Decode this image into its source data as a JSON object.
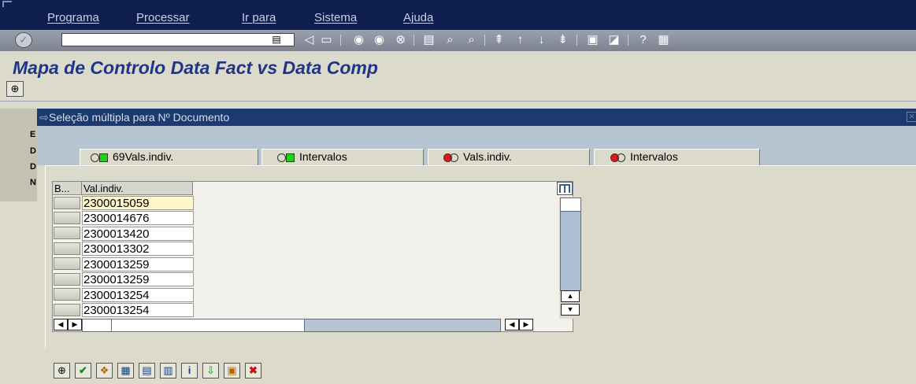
{
  "menu": {
    "items": [
      "Programa",
      "Processar",
      "Ir para",
      "Sistema",
      "Ajuda"
    ]
  },
  "toolbar": {
    "command_field_value": "",
    "icons": [
      "enter-icon",
      "back-icon",
      "save-icon",
      "back-nav-icon",
      "exit-icon",
      "cancel-icon",
      "print-icon",
      "find-icon",
      "find-next-icon",
      "first-page-icon",
      "previous-page-icon",
      "next-page-icon",
      "last-page-icon",
      "new-session-icon",
      "shortcut-icon",
      "help-icon",
      "layout-icon"
    ]
  },
  "page": {
    "title": "Mapa de Controlo Data Fact vs Data Comp"
  },
  "dialog": {
    "title": "Seleção múltipla para Nº Documento",
    "tabs": [
      {
        "label": "69Vals.indiv.",
        "status": "green",
        "active": true
      },
      {
        "label": "Intervalos",
        "status": "green",
        "active": false
      },
      {
        "label": "Vals.indiv.",
        "status": "red",
        "active": false
      },
      {
        "label": "Intervalos",
        "status": "red",
        "active": false
      }
    ],
    "table": {
      "col_sel": "B...",
      "col_value": "Val.indiv.",
      "rows": [
        "2300015059",
        "2300014676",
        "2300013420",
        "2300013302",
        "2300013259",
        "2300013259",
        "2300013254",
        "2300013254"
      ]
    },
    "bottom_buttons": [
      "execute-icon",
      "check-icon",
      "multiple-selection-icon",
      "insert-line-icon",
      "delete-line-icon",
      "delete-all-icon",
      "info-icon",
      "import-icon",
      "clipboard-upload-icon",
      "cancel-icon"
    ]
  },
  "left_strip": {
    "chars": [
      "E",
      "D",
      "D",
      "N"
    ]
  },
  "colors": {
    "menubar": "#0e1f4f",
    "title": "#1f3688",
    "dialog_title": "#1d3a6e",
    "tab_header": "#b7c5d3",
    "background": "#dcdacb"
  }
}
